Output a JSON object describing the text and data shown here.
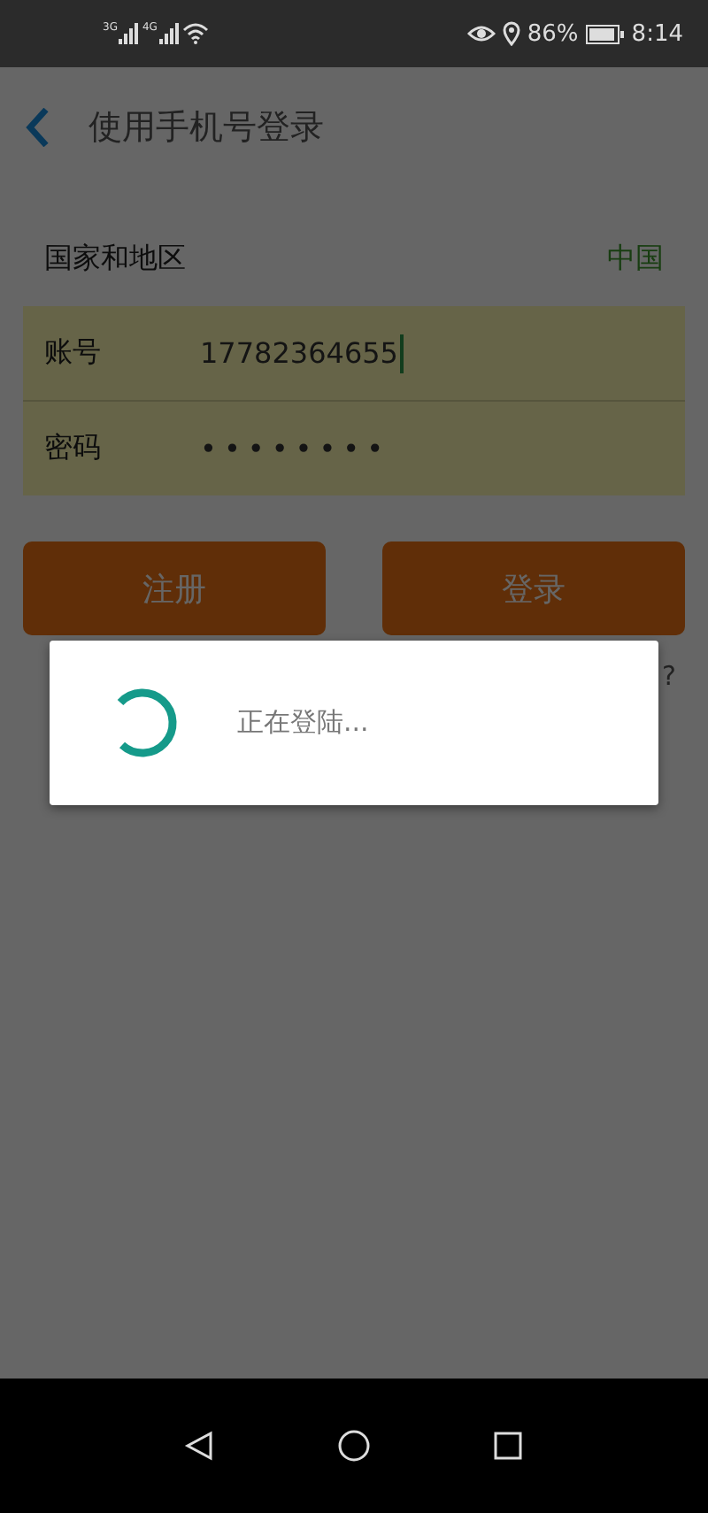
{
  "status_bar": {
    "network_labels": [
      "3G",
      "4G"
    ],
    "battery": "86%",
    "time": "8:14"
  },
  "header": {
    "title": "使用手机号登录"
  },
  "region": {
    "label": "国家和地区",
    "value": "中国"
  },
  "fields": [
    {
      "label": "账号",
      "value": "17782364655",
      "kind": "text",
      "focused": true
    },
    {
      "label": "密码",
      "value": "••••••••",
      "kind": "password",
      "focused": false
    }
  ],
  "buttons": [
    {
      "label": "注册"
    },
    {
      "label": "登录"
    }
  ],
  "text_behind_dialog": "?",
  "dialog": {
    "message": "正在登陆..."
  }
}
